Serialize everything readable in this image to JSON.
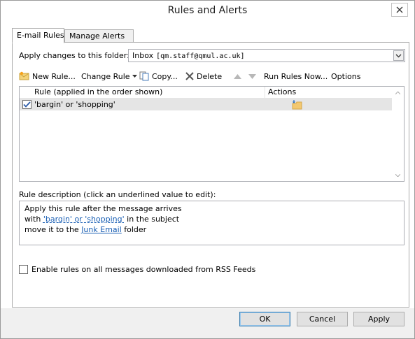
{
  "window": {
    "title": "Rules and Alerts"
  },
  "tabs": [
    {
      "label": "E-mail Rules",
      "active": true
    },
    {
      "label": "Manage Alerts",
      "active": false
    }
  ],
  "folder": {
    "label": "Apply changes to this folder:",
    "value": "Inbox",
    "account": "[qm.staff@qmul.ac.uk]"
  },
  "toolbar": {
    "new_rule": "New Rule...",
    "change_rule": "Change Rule",
    "copy": "Copy...",
    "delete": "Delete",
    "run_rules": "Run Rules Now...",
    "options": "Options"
  },
  "rules_list": {
    "col_rule": "Rule (applied in the order shown)",
    "col_actions": "Actions",
    "rows": [
      {
        "name": "'bargin' or 'shopping'",
        "checked": true,
        "action_icon": "move-to-folder-icon"
      }
    ]
  },
  "description": {
    "label": "Rule description (click an underlined value to edit):",
    "line1": "Apply this rule after the message arrives",
    "line2_prefix": "with",
    "line2_link": "'bargin' or 'shopping'",
    "line2_suffix": "in the subject",
    "line3_prefix": "move it to the",
    "line3_link": "Junk Email",
    "line3_suffix": "folder"
  },
  "rss": {
    "label": "Enable rules on all messages downloaded from RSS Feeds",
    "checked": false
  },
  "buttons": {
    "ok": "OK",
    "cancel": "Cancel",
    "apply": "Apply"
  },
  "colors": {
    "accent": "#1a5fb4",
    "selection": "#e5e5e5"
  }
}
